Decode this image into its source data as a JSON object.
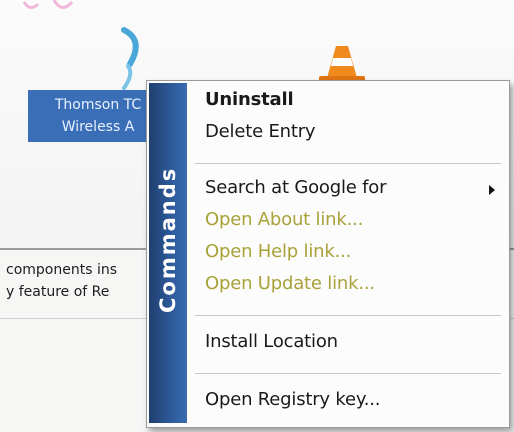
{
  "program": {
    "name_line1": "Thomson TC",
    "name_line2": "Wireless A"
  },
  "description": {
    "line1": "components ins",
    "line2": "y feature of Re"
  },
  "context_menu": {
    "sidebar_title": "Commands",
    "items": [
      {
        "label": "Uninstall"
      },
      {
        "label": "Delete Entry"
      },
      {
        "label": "Search at Google for"
      },
      {
        "label": "Open About link..."
      },
      {
        "label": "Open Help link..."
      },
      {
        "label": "Open Update link..."
      },
      {
        "label": "Install Location"
      },
      {
        "label": "Open Registry key..."
      }
    ]
  },
  "icons": [
    "wifi-icon",
    "vlc-cone-icon",
    "submenu-arrow-icon"
  ],
  "colors": {
    "selection": "#3a6fb8",
    "sidebar": "#2e5b9c",
    "link_text": "#a9a23a"
  }
}
